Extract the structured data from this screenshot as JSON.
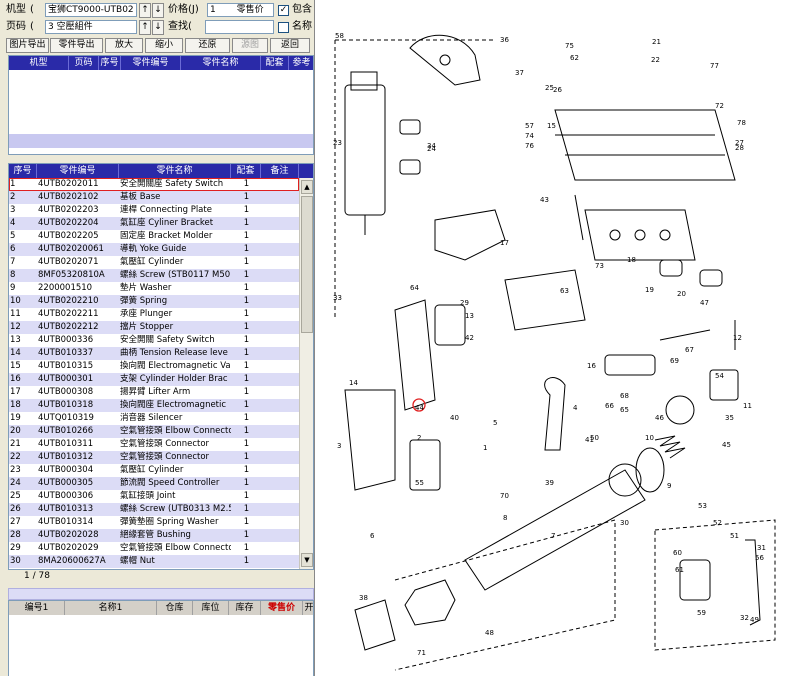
{
  "toolbar": {
    "model_label": "机型",
    "model_value": "宝狮CT9000-UTB02",
    "page_label": "页码",
    "page_value": "3 空壓組件",
    "price_label": "价格(J)",
    "price_value": "1",
    "price_type": "零售价",
    "include_label": "包含",
    "find_label": "查找(",
    "name_label": "名称",
    "buttons": [
      "图片导出",
      "零件导出",
      "放大",
      "缩小",
      "还原",
      "源图",
      "返回"
    ]
  },
  "top_table": {
    "headers": [
      "机型",
      "页码",
      "序号",
      "零件编号",
      "零件名称",
      "配套",
      "参考"
    ]
  },
  "parts_table": {
    "headers": [
      "序号",
      "零件编号",
      "零件名称",
      "配套",
      "备注"
    ],
    "rows": [
      [
        "1",
        "4UTB0202011",
        "安全開關座 Safety Switch",
        "1"
      ],
      [
        "2",
        "4UTB0202102",
        "基板 Base",
        "1"
      ],
      [
        "3",
        "4UTB0202203",
        "連桿 Connecting Plate",
        "1"
      ],
      [
        "4",
        "4UTB0202204",
        "氣缸座 Cyliner Bracket",
        "1"
      ],
      [
        "5",
        "4UTB0202205",
        "固定座 Bracket Molder",
        "1"
      ],
      [
        "6",
        "4UTB02020061",
        "導軌 Yoke Guide",
        "1"
      ],
      [
        "7",
        "4UTB0202071",
        "氣壓缸 Cylinder",
        "1"
      ],
      [
        "8",
        "8MF05320810A",
        "螺絲 Screw (STB0117 M50.8",
        "1"
      ],
      [
        "9",
        "2200001510",
        "墊片 Washer",
        "1"
      ],
      [
        "10",
        "4UTB0202210",
        "彈簧 Spring",
        "1"
      ],
      [
        "11",
        "4UTB0202211",
        "承座 Plunger",
        "1"
      ],
      [
        "12",
        "4UTB0202212",
        "擋片 Stopper",
        "1"
      ],
      [
        "13",
        "4UTB000336",
        "安全開關 Safety Switch",
        "1"
      ],
      [
        "14",
        "4UTB010337",
        "曲柄 Tension Release leve",
        "1"
      ],
      [
        "15",
        "4UTB010315",
        "換向閥 Electromagnetic Va",
        "1"
      ],
      [
        "16",
        "4UTB000301",
        "支架 Cylinder Holder Brac",
        "1"
      ],
      [
        "17",
        "4UTB000308",
        "揚昇臂 Lifter Arm",
        "1"
      ],
      [
        "18",
        "4UTB010318",
        "換向閥座 Electromagnetic",
        "1"
      ],
      [
        "19",
        "4UTQ010319",
        "消音器 Silencer",
        "1"
      ],
      [
        "20",
        "4UTB010266",
        "空氣管接頭 Elbow Connecto",
        "1"
      ],
      [
        "21",
        "4UTB010311",
        "空氣管接頭 Connector",
        "1"
      ],
      [
        "22",
        "4UTB010312",
        "空氣管接頭 Connector",
        "1"
      ],
      [
        "23",
        "4UTB000304",
        "氣壓缸 Cylinder",
        "1"
      ],
      [
        "24",
        "4UTB000305",
        "節流閥 Speed Controller",
        "1"
      ],
      [
        "25",
        "4UTB000306",
        "氣缸接頭 Joint",
        "1"
      ],
      [
        "26",
        "4UTB010313",
        "螺絲 Screw (UTB0313 M2.50",
        "1"
      ],
      [
        "27",
        "4UTB010314",
        "彈簧墊圈 Spring Washer",
        "1"
      ],
      [
        "28",
        "4UTB0202028",
        "絕緣套管 Bushing",
        "1"
      ],
      [
        "29",
        "4UTB0202029",
        "空氣管接頭 Elbow Connecto",
        "1"
      ],
      [
        "30",
        "8MA20600627A",
        "螺帽 Nut",
        "1"
      ]
    ]
  },
  "pagination": {
    "text": "1 / 78"
  },
  "bottom_table": {
    "headers": [
      "编号1",
      "名称1",
      "仓库",
      "库位",
      "库存",
      "零售价",
      "开"
    ]
  },
  "diagram": {
    "callouts": [
      "1",
      "2",
      "3",
      "4",
      "5",
      "6",
      "7",
      "8",
      "9",
      "10",
      "11",
      "12",
      "13",
      "14",
      "15",
      "16",
      "17",
      "18",
      "19",
      "20",
      "21",
      "22",
      "23",
      "24",
      "25",
      "26",
      "27",
      "28",
      "29",
      "30",
      "31",
      "32",
      "33",
      "34",
      "35",
      "36",
      "37",
      "38",
      "39",
      "40",
      "41",
      "42",
      "43",
      "44",
      "45",
      "46",
      "47",
      "48",
      "49",
      "50",
      "51",
      "52",
      "53",
      "54",
      "55",
      "56",
      "57",
      "58",
      "59",
      "60",
      "61",
      "62",
      "63",
      "64",
      "65",
      "66",
      "67",
      "68",
      "69",
      "70",
      "71",
      "72",
      "73",
      "74",
      "75",
      "76",
      "77",
      "78"
    ]
  },
  "colors": {
    "header_bg": "#2a2aa8",
    "stripe": "#dcdcf6",
    "selected_outline": "#e02020",
    "price_highlight": "#cc0000"
  }
}
